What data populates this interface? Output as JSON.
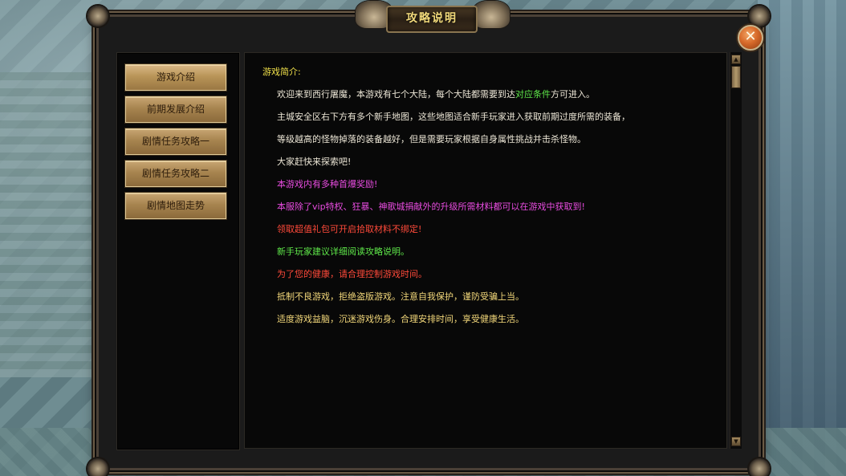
{
  "window": {
    "title": "攻略说明",
    "close_symbol": "✕"
  },
  "nav": {
    "items": [
      {
        "label": "游戏介绍"
      },
      {
        "label": "前期发展介绍"
      },
      {
        "label": "剧情任务攻略一"
      },
      {
        "label": "剧情任务攻略二"
      },
      {
        "label": "剧情地图走势"
      }
    ]
  },
  "content": {
    "heading": "游戏简介:",
    "para1_prefix": "欢迎来到西行屠魔，本游戏有七个大陆，每个大陆都需要到达",
    "para1_highlight": "对应条件",
    "para1_suffix": "方可进入。",
    "para2": "主城安全区右下方有多个新手地图，这些地图适合新手玩家进入获取前期过度所需的装备，",
    "para3": "等级越高的怪物掉落的装备越好，但是需要玩家根据自身属性挑战并击杀怪物。",
    "para4": "大家赶快来探索吧!",
    "para5": "本游戏内有多种首爆奖励!",
    "para6": "本服除了vip特权、狂暴、神歌城捐献外的升级所需材料都可以在游戏中获取到!",
    "para7": "领取超值礼包可开启拾取材料不绑定!",
    "para8": "新手玩家建议详细阅读攻略说明。",
    "para9": "为了您的健康，请合理控制游戏时间。",
    "para10": "抵制不良游戏，拒绝盗版游戏。注意自我保护，谨防受骗上当。",
    "para11": "适度游戏益脑，沉迷游戏伤身。合理安排时间，享受健康生活。"
  },
  "scrollbar": {
    "up_symbol": "▲",
    "down_symbol": "▼",
    "scroll_position": 0
  },
  "colors": {
    "heading": "#f0e04a",
    "body": "#ece6d6",
    "highlight_green": "#5fe84a",
    "magenta": "#e84ce0",
    "red": "#ff4a3a",
    "gold": "#f2d77a"
  },
  "icons": {
    "close": "close-icon",
    "scroll_up": "chevron-up-icon",
    "scroll_down": "chevron-down-icon"
  }
}
